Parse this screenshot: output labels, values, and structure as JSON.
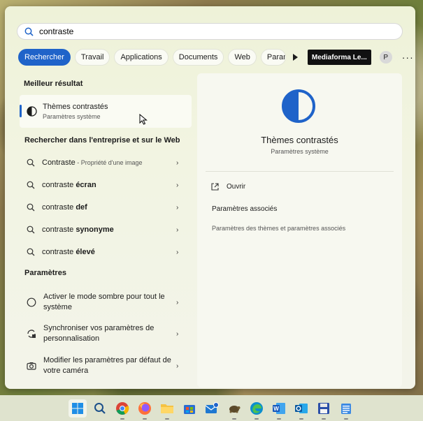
{
  "search": {
    "value": "contraste"
  },
  "chips": [
    {
      "label": "Rechercher",
      "active": true
    },
    {
      "label": "Travail"
    },
    {
      "label": "Applications"
    },
    {
      "label": "Documents"
    },
    {
      "label": "Web"
    },
    {
      "label": "Param"
    }
  ],
  "org_label": "Mediaforma Le...",
  "avatar_letter": "P",
  "sections": {
    "best": "Meilleur résultat",
    "web": "Rechercher dans l'entreprise et sur le Web",
    "settings": "Paramètres"
  },
  "best_result": {
    "title": "Thèmes contrastés",
    "subtitle": "Paramètres système"
  },
  "web_results": [
    {
      "normal": "Contraste",
      "extra": " - Propriété d'une image"
    },
    {
      "normal": "contraste ",
      "bold": "écran"
    },
    {
      "normal": "contraste ",
      "bold": "def"
    },
    {
      "normal": "contraste ",
      "bold": "synonyme"
    },
    {
      "normal": "contraste ",
      "bold": "élevé"
    }
  ],
  "settings_results": [
    {
      "label": "Activer le mode sombre pour tout le système",
      "icon": "dark-mode-icon"
    },
    {
      "label": "Synchroniser vos paramètres de personnalisation",
      "icon": "sync-icon"
    },
    {
      "label": "Modifier les paramètres par défaut de votre caméra",
      "icon": "camera-icon"
    }
  ],
  "preview": {
    "title": "Thèmes contrastés",
    "subtitle": "Paramètres système",
    "open": "Ouvrir",
    "assoc_title": "Paramètres associés",
    "assoc_link": "Paramètres des thèmes et paramètres associés"
  },
  "colors": {
    "accent": "#1f63c9"
  },
  "taskbar": [
    "windows-start",
    "search",
    "chrome",
    "firefox",
    "file-explorer",
    "store",
    "mail",
    "tortoise",
    "edge",
    "word",
    "outlook",
    "save",
    "notepad"
  ]
}
